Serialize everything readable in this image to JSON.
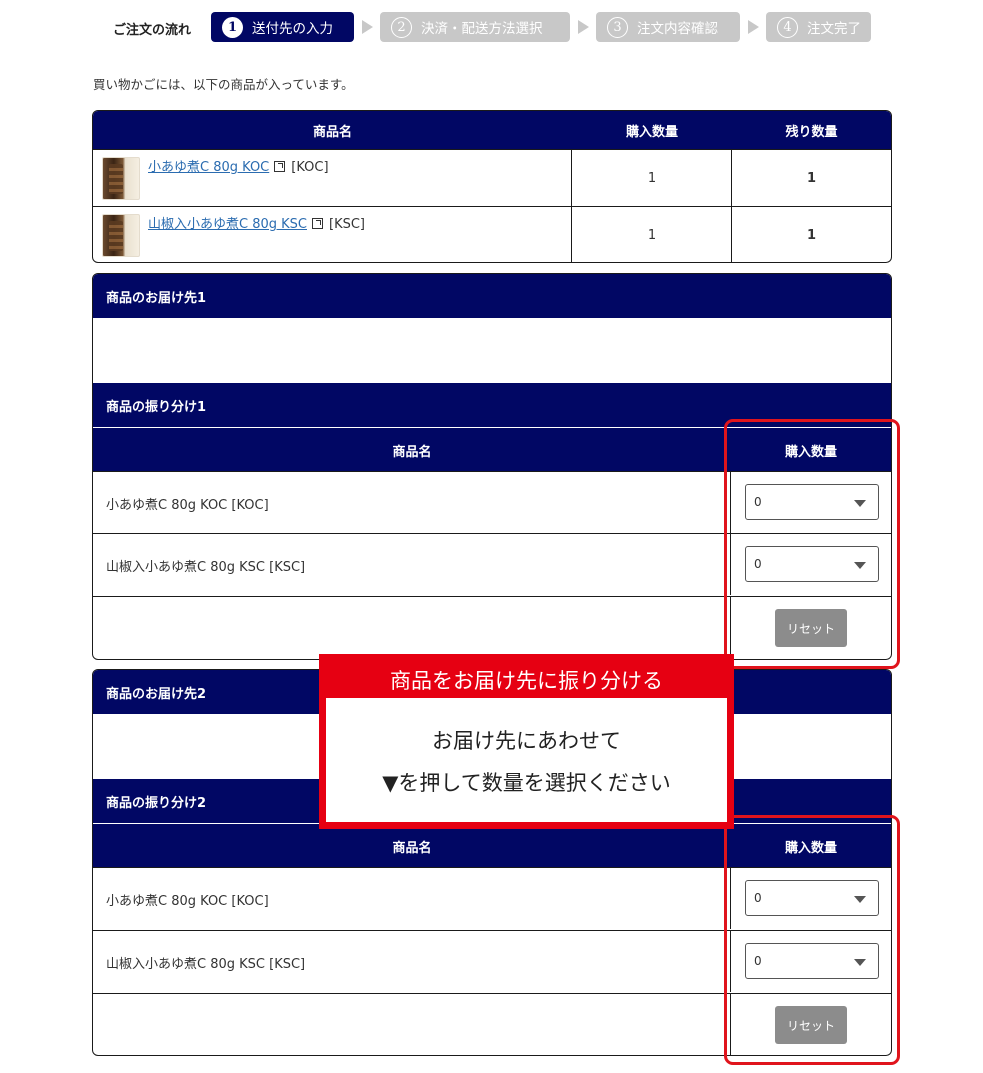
{
  "flow": {
    "label": "ご注文の流れ",
    "steps": [
      {
        "num": "1",
        "label": "送付先の入力"
      },
      {
        "num": "2",
        "label": "決済・配送方法選択"
      },
      {
        "num": "3",
        "label": "注文内容確認"
      },
      {
        "num": "4",
        "label": "注文完了"
      }
    ]
  },
  "intro_text": "買い物かごには、以下の商品が入っています。",
  "cart": {
    "headers": [
      "商品名",
      "購入数量",
      "残り数量"
    ],
    "rows": [
      {
        "name": "小あゆ煮C 80g KOC",
        "code": "[KOC]",
        "qty": "1",
        "remaining": "1"
      },
      {
        "name": "山椒入小あゆ煮C 80g KSC",
        "code": "[KSC]",
        "qty": "1",
        "remaining": "1"
      }
    ]
  },
  "destinations": [
    {
      "title": "商品のお届け先1",
      "alloc_title": "商品の振り分け1",
      "headers": [
        "商品名",
        "購入数量"
      ],
      "rows": [
        {
          "name": "小あゆ煮C 80g KOC [KOC]",
          "qty": "0"
        },
        {
          "name": "山椒入小あゆ煮C 80g KSC [KSC]",
          "qty": "0"
        }
      ],
      "reset_label": "リセット"
    },
    {
      "title": "商品のお届け先2",
      "alloc_title": "商品の振り分け2",
      "headers": [
        "商品名",
        "購入数量"
      ],
      "rows": [
        {
          "name": "小あゆ煮C 80g KOC [KOC]",
          "qty": "0"
        },
        {
          "name": "山椒入小あゆ煮C 80g KSC [KSC]",
          "qty": "0"
        }
      ],
      "reset_label": "リセット"
    }
  ],
  "callout": {
    "title": "商品をお届け先に振り分ける",
    "line1": "お届け先にあわせて",
    "line2": "▼を押して数量を選択ください"
  },
  "colors": {
    "navy": "#010764",
    "highlight_red": "#e60012",
    "step_inactive": "#c8c8c8",
    "reset_gray": "#8c8c8c"
  }
}
